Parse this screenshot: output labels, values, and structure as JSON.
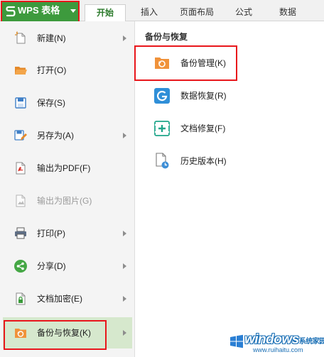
{
  "app": {
    "menu_button_label": "WPS 表格",
    "brand_color": "#3d9a3d",
    "highlight_color": "#e8161b"
  },
  "ribbon": {
    "tabs": [
      {
        "label": "开始",
        "active": true
      },
      {
        "label": "插入",
        "active": false
      },
      {
        "label": "页面布局",
        "active": false
      },
      {
        "label": "公式",
        "active": false
      },
      {
        "label": "数据",
        "active": false
      }
    ]
  },
  "file_menu": {
    "items": [
      {
        "label": "新建(N)",
        "icon": "new-file-icon",
        "has_submenu": true,
        "disabled": false
      },
      {
        "label": "打开(O)",
        "icon": "open-folder-icon",
        "has_submenu": false,
        "disabled": false
      },
      {
        "label": "保存(S)",
        "icon": "save-disk-icon",
        "has_submenu": false,
        "disabled": false
      },
      {
        "label": "另存为(A)",
        "icon": "save-as-icon",
        "has_submenu": true,
        "disabled": false
      },
      {
        "label": "输出为PDF(F)",
        "icon": "pdf-export-icon",
        "has_submenu": false,
        "disabled": false
      },
      {
        "label": "输出为图片(G)",
        "icon": "image-export-icon",
        "has_submenu": false,
        "disabled": true
      },
      {
        "label": "打印(P)",
        "icon": "printer-icon",
        "has_submenu": true,
        "disabled": false
      },
      {
        "label": "分享(D)",
        "icon": "share-icon",
        "has_submenu": true,
        "disabled": false
      },
      {
        "label": "文档加密(E)",
        "icon": "document-lock-icon",
        "has_submenu": true,
        "disabled": false
      },
      {
        "label": "备份与恢复(K)",
        "icon": "backup-folder-icon",
        "has_submenu": true,
        "disabled": false,
        "active": true
      }
    ]
  },
  "backup_panel": {
    "title": "备份与恢复",
    "items": [
      {
        "label": "备份管理(K)",
        "icon": "backup-management-icon"
      },
      {
        "label": "数据恢复(R)",
        "icon": "data-recovery-icon"
      },
      {
        "label": "文档修复(F)",
        "icon": "document-repair-icon"
      },
      {
        "label": "历史版本(H)",
        "icon": "history-version-icon"
      }
    ]
  },
  "watermark": {
    "brand": "windows",
    "brand_suffix": "系统家园",
    "url": "www.ruihaitu.com"
  }
}
